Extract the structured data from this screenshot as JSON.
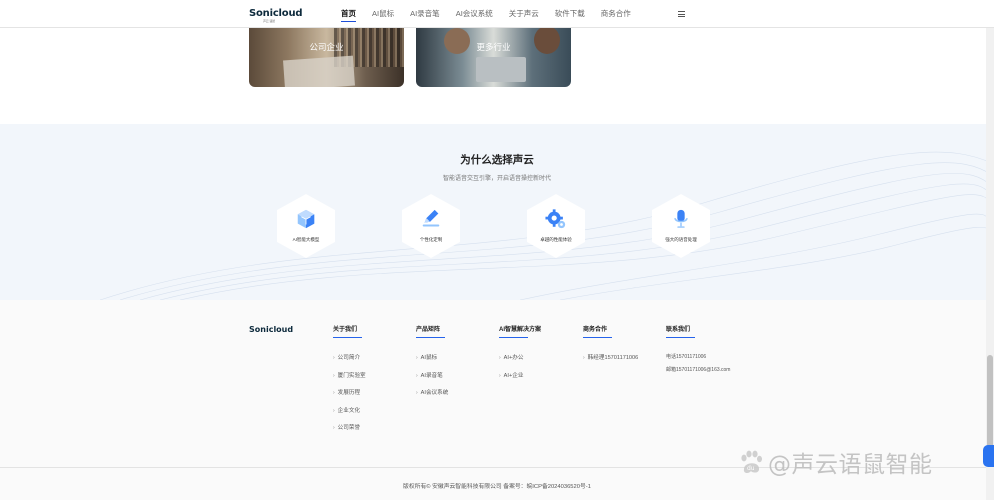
{
  "header": {
    "logo": "Sonicloud",
    "logo_sub": "声云 语鼠",
    "nav": [
      "首页",
      "AI鼠标",
      "AI录音笔",
      "AI会议系统",
      "关于声云",
      "软件下载",
      "商务合作"
    ],
    "active_index": 0
  },
  "industries": [
    {
      "label": "公司企业"
    },
    {
      "label": "更多行业"
    }
  ],
  "why": {
    "title": "为什么选择声云",
    "subtitle": "智能语音交互引擎，开启语音操控新时代",
    "features": [
      {
        "label": "AI智能大模型",
        "icon": "cube-icon"
      },
      {
        "label": "个性化定制",
        "icon": "pen-icon"
      },
      {
        "label": "卓越的性能体验",
        "icon": "gear-icon"
      },
      {
        "label": "强大的语音处理",
        "icon": "microphone-icon"
      }
    ]
  },
  "footer": {
    "logo": "Sonicloud",
    "columns": [
      {
        "title": "关于我们",
        "items": [
          "公司简介",
          "厦门实验室",
          "发展历程",
          "企业文化",
          "公司荣誉"
        ]
      },
      {
        "title": "产品矩阵",
        "items": [
          "AI鼠标",
          "AI录音笔",
          "AI会议系统"
        ]
      },
      {
        "title": "AI智慧解决方案",
        "items": [
          "AI+办公",
          "AI+企业"
        ]
      },
      {
        "title": "商务合作",
        "items": [
          "韩经理15701171006"
        ]
      }
    ],
    "contact": {
      "title": "联系我们",
      "phone": "电话15701171006",
      "email": "邮箱15701171006@163.com"
    },
    "copyright": "版权所有© 安徽声云智能科技有限公司 备案号：皖ICP备2024036520号-1"
  },
  "watermark": "@声云语鼠智能",
  "colors": {
    "accent": "#2563eb",
    "icon_blue": "#3b82f6",
    "section_bg": "#f2f6fb"
  }
}
